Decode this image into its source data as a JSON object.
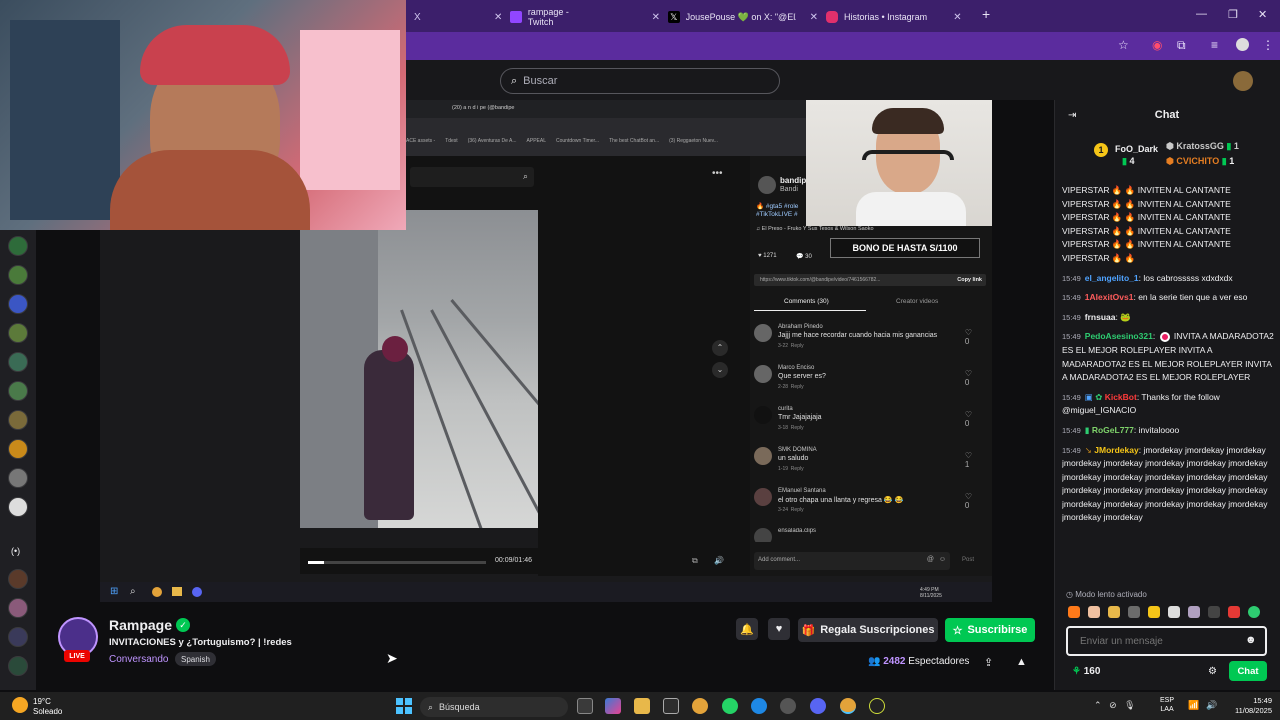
{
  "browser": {
    "tabs": [
      {
        "label": "rampage - Twitch",
        "color": "#9146ff"
      },
      {
        "label": "JousePouse 💚 on X: \"@ElZeen",
        "color": "#000000"
      },
      {
        "label": "Historias • Instagram",
        "color": "#e1306c"
      }
    ],
    "first_tab_close": "X"
  },
  "twitch": {
    "search_placeholder": "Buscar"
  },
  "tiktok": {
    "window_tab": "(20) a n d i pe (@bandipe",
    "bookmarks": [
      "ACE assets -",
      "Tdest",
      "(36) Aventuras De A...",
      "APPEAL",
      "Countdown Timer...",
      "The best ChatBot an...",
      "(3) Reggaeton Nuev..."
    ],
    "user_handle": "bandip",
    "user_name": "Bandi",
    "hashtags_line1": "🔥 #gta5 #role",
    "hashtags_line2": "#TikTokLIVE #",
    "song": "♫ El Preso - Fruko Y Sus Tesos & Wilson Saoko",
    "likes": "1271",
    "comments_count": "30",
    "link": "https://www.tiktok.com/@bandipe/video/7461566782...",
    "copy_link": "Copy link",
    "tab_comments": "Comments (30)",
    "tab_creator": "Creator videos",
    "video_time": "00:09/01:46",
    "add_comment": "Add comment...",
    "post": "Post",
    "bono": "BONO DE HASTA S/1100",
    "inner_clock": "4:49 PM\n8/11/2025",
    "comments": [
      {
        "name": "Abraham Pinedo",
        "text": "Jajjj me hace recordar cuando hacia mis ganancias",
        "date": "3-22",
        "reply": "Reply",
        "likes": "0"
      },
      {
        "name": "Marco Enciso",
        "text": "Que server es?",
        "date": "2-28",
        "reply": "Reply",
        "likes": "0"
      },
      {
        "name": "curita",
        "text": "Tmr Jajajajaja",
        "date": "3-18",
        "reply": "Reply",
        "likes": "0"
      },
      {
        "name": "SMK DOMINA",
        "text": "un saludo",
        "date": "1-19",
        "reply": "Reply",
        "likes": "1"
      },
      {
        "name": "EManuel Santana",
        "text": "el otro chapa una llanta y regresa 😂 😂",
        "date": "3-24",
        "reply": "Reply",
        "likes": "0"
      },
      {
        "name": "ensalada.clips",
        "text": "",
        "date": "",
        "reply": "",
        "likes": ""
      }
    ]
  },
  "stream": {
    "channel": "Rampage",
    "title": "INVITACIONES y ¿Tortuguismo? | !redes",
    "category": "Conversando",
    "language": "Spanish",
    "live": "LIVE",
    "gift_label": "Regala Suscripciones",
    "subscribe_label": "Suscribirse",
    "viewer_count": "2482",
    "viewer_label": "Espectadores"
  },
  "chat": {
    "title": "Chat",
    "leaders": [
      {
        "name": "FoO_Dark",
        "count": "4",
        "color": "#f5c518"
      },
      {
        "name": "KratossGG",
        "count": "1",
        "color": "#c0c0c0"
      },
      {
        "name": "CVICHITO",
        "count": "1",
        "color": "#e67e22"
      }
    ],
    "messages": [
      {
        "ts": "",
        "user": "",
        "color": "#efeff1",
        "text": "VIPERSTAR 🔥 🔥 INVITEN AL CANTANTE VIPERSTAR 🔥 🔥 INVITEN AL CANTANTE VIPERSTAR 🔥 🔥 INVITEN AL CANTANTE VIPERSTAR 🔥 🔥 INVITEN AL CANTANTE VIPERSTAR 🔥 🔥 INVITEN AL CANTANTE VIPERSTAR 🔥 🔥"
      },
      {
        "ts": "15:49",
        "user": "el_angelito_1",
        "color": "#4fa3ff",
        "text": "los cabrosssss xdxdxdx"
      },
      {
        "ts": "15:49",
        "user": "1AlexitOvs1",
        "color": "#ff5c5c",
        "text": "en la serie tien que a ver eso"
      },
      {
        "ts": "15:49",
        "user": "frnsuaa",
        "color": "#efeff1",
        "text": "🐸"
      },
      {
        "ts": "15:49",
        "user": "PedoAsesino321",
        "color": "#2ecc71",
        "text": "INVITA A MADARADOTA2 ES EL MEJOR ROLEPLAYER INVITA A MADARADOTA2 ES EL MEJOR ROLEPLAYER INVITA A MADARADOTA2 ES EL MEJOR ROLEPLAYER"
      },
      {
        "ts": "15:49",
        "user": "KickBot",
        "color": "#ff3b3b",
        "text": "Thanks for the follow @miguel_IGNACIO"
      },
      {
        "ts": "15:49",
        "user": "RoGeL777",
        "color": "#7fd36b",
        "text": "invitaloooo"
      },
      {
        "ts": "15:49",
        "user": "JMordekay",
        "color": "#f5c518",
        "text": "jmordekay jmordekay jmordekay jmordekay jmordekay jmordekay jmordekay jmordekay jmordekay jmordekay jmordekay jmordekay jmordekay jmordekay jmordekay jmordekay jmordekay jmordekay jmordekay jmordekay jmordekay jmordekay jmordekay jmordekay jmordekay"
      }
    ],
    "slow_mode": "Modo lento activado",
    "input_placeholder": "Enviar un mensaje",
    "points": "160",
    "send_label": "Chat"
  },
  "taskbar": {
    "temp": "19°C",
    "weather": "Soleado",
    "search": "Búsqueda",
    "lang_top": "ESP",
    "lang_bottom": "LAA",
    "time": "15:49",
    "date": "11/08/2025"
  },
  "colors": {
    "accent_purple": "#bf94ff",
    "twitch_green": "#00c853",
    "live_red": "#eb0400"
  }
}
